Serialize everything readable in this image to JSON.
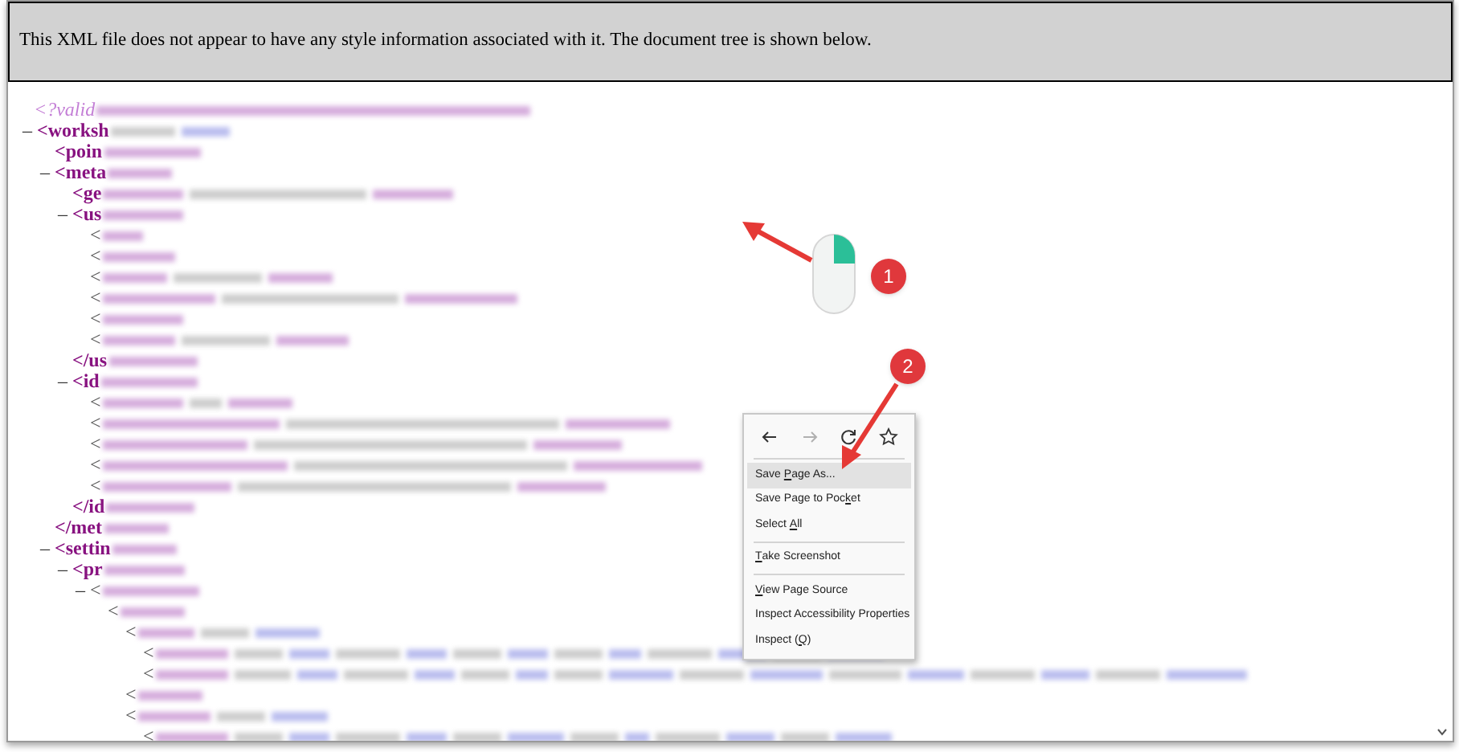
{
  "banner": {
    "text": "This XML file does not appear to have any style information associated with it. The document tree is shown below."
  },
  "xml_tree": [
    {
      "kind": "pi",
      "tag": "<?valid"
    },
    {
      "kind": "element",
      "toggle": "–",
      "tag": "<worksh",
      "children": [
        {
          "kind": "element",
          "tag": "<poin"
        },
        {
          "kind": "element",
          "toggle": "–",
          "tag": "<meta",
          "children": [
            {
              "kind": "element",
              "tag": "<ge"
            },
            {
              "kind": "element",
              "toggle": "–",
              "tag": "<us",
              "close": "</us",
              "children": [
                {
                  "kind": "element",
                  "tag": "<"
                },
                {
                  "kind": "element",
                  "tag": "<"
                },
                {
                  "kind": "element",
                  "tag": "<"
                },
                {
                  "kind": "element",
                  "tag": "<"
                },
                {
                  "kind": "element",
                  "tag": "<"
                },
                {
                  "kind": "element",
                  "tag": "<"
                }
              ]
            },
            {
              "kind": "element",
              "toggle": "–",
              "tag": "<id",
              "close": "</id",
              "children": [
                {
                  "kind": "element",
                  "tag": "<"
                },
                {
                  "kind": "element",
                  "tag": "<"
                },
                {
                  "kind": "element",
                  "tag": "<"
                },
                {
                  "kind": "element",
                  "tag": "<"
                },
                {
                  "kind": "element",
                  "tag": "<"
                }
              ]
            }
          ],
          "close": "</met"
        },
        {
          "kind": "element",
          "toggle": "–",
          "tag": "<settin",
          "children": [
            {
              "kind": "element",
              "toggle": "–",
              "tag": "<pr",
              "children": [
                {
                  "kind": "element",
                  "toggle": "–",
                  "tag": "<",
                  "children": [
                    {
                      "kind": "element",
                      "tag": "<",
                      "children": [
                        {
                          "kind": "element",
                          "tag": "<",
                          "children": [
                            {
                              "kind": "element",
                              "tag": "<"
                            },
                            {
                              "kind": "element",
                              "tag": "<"
                            }
                          ],
                          "close": "<"
                        },
                        {
                          "kind": "element",
                          "tag": "<",
                          "children": [
                            {
                              "kind": "element",
                              "tag": "<"
                            }
                          ]
                        }
                      ]
                    }
                  ]
                }
              ]
            }
          ]
        }
      ]
    }
  ],
  "context_menu": {
    "nav": [
      {
        "kind": "back",
        "disabled": false
      },
      {
        "kind": "forward",
        "disabled": true
      },
      {
        "kind": "reload",
        "disabled": false
      },
      {
        "kind": "bookmark",
        "disabled": false
      }
    ],
    "items": [
      {
        "kind": "item",
        "before": "Save ",
        "key": "P",
        "after": "age As...",
        "selected": true
      },
      {
        "kind": "item",
        "before": "Save Page to Poc",
        "key": "k",
        "after": "et",
        "selected": false
      },
      {
        "kind": "item",
        "before": "Select ",
        "key": "A",
        "after": "ll",
        "selected": false
      },
      {
        "kind": "separator"
      },
      {
        "kind": "item",
        "key": "T",
        "after": "ake Screenshot",
        "selected": false
      },
      {
        "kind": "separator"
      },
      {
        "kind": "item",
        "key": "V",
        "after": "iew Page Source",
        "selected": false
      },
      {
        "kind": "item",
        "before": "Inspect Accessibility Properties",
        "selected": false
      },
      {
        "kind": "item",
        "before": "Inspect (",
        "key": "Q",
        "after": ")",
        "selected": false
      }
    ]
  },
  "callouts": [
    {
      "text": "1"
    },
    {
      "text": "2"
    }
  ]
}
